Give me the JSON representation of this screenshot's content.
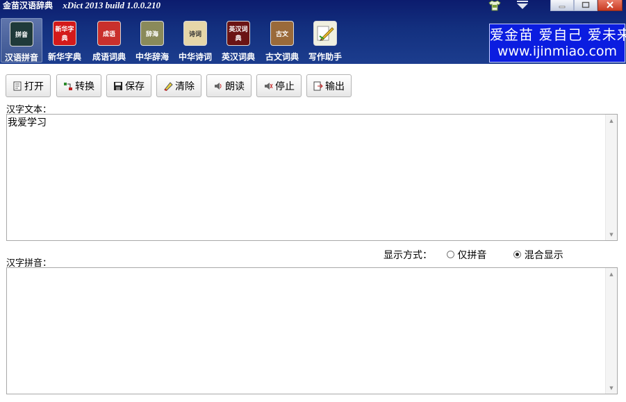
{
  "window": {
    "app_title": "金苗汉语辞典",
    "version_text": "xDict 2013  build 1.0.0.210",
    "skin_icon": "tshirt-icon",
    "dropdown_icon": "chevron-down-icon",
    "controls": [
      "minimize-icon",
      "maximize-icon",
      "close-icon"
    ]
  },
  "nav": {
    "active": "汉语拼音",
    "items": [
      {
        "label": "汉语拼音",
        "icon": "pinyin-book-icon",
        "color": "#1f3a3a",
        "text": "拼音"
      },
      {
        "label": "新华字典",
        "icon": "xinhua-dictionary-icon",
        "color": "#d41a1a",
        "text": "新华字典"
      },
      {
        "label": "成语词典",
        "icon": "idiom-dictionary-icon",
        "color": "#c9302c",
        "text": "成语"
      },
      {
        "label": "中华辞海",
        "icon": "cihai-icon",
        "color": "#8a8a5a",
        "text": "辞海"
      },
      {
        "label": "中华诗词",
        "icon": "poetry-icon",
        "color": "#e6d6a8",
        "text": "诗词"
      },
      {
        "label": "英汉词典",
        "icon": "english-chinese-dictionary-icon",
        "color": "#6b1414",
        "text": "英汉词典"
      },
      {
        "label": "古文词典",
        "icon": "classical-chinese-icon",
        "color": "#9a6a3a",
        "text": "古文"
      },
      {
        "label": "写作助手",
        "icon": "writing-pencil-icon",
        "color": "#f0f0e0",
        "text": ""
      }
    ]
  },
  "banner": {
    "line1": "爱金苗 爱自己 爱未来",
    "line2": "www.ijinmiao.com"
  },
  "toolbar": {
    "buttons": [
      {
        "label": "打开",
        "icon": "open-file-icon"
      },
      {
        "label": "转换",
        "icon": "convert-icon"
      },
      {
        "label": "保存",
        "icon": "save-icon"
      },
      {
        "label": "清除",
        "icon": "eraser-icon"
      },
      {
        "label": "朗读",
        "icon": "speaker-icon"
      },
      {
        "label": "停止",
        "icon": "stop-speaker-icon"
      },
      {
        "label": "输出",
        "icon": "export-icon"
      }
    ]
  },
  "hanzi": {
    "label": "汉字文本：",
    "value": "我爱学习"
  },
  "pinyin": {
    "label": "汉字拼音：",
    "value": ""
  },
  "display_mode": {
    "label": "显示方式：",
    "options": [
      "仅拼音",
      "混合显示"
    ],
    "selected": "混合显示"
  },
  "colors": {
    "titlebar": "#13307f",
    "banner": "#0b1de0"
  }
}
